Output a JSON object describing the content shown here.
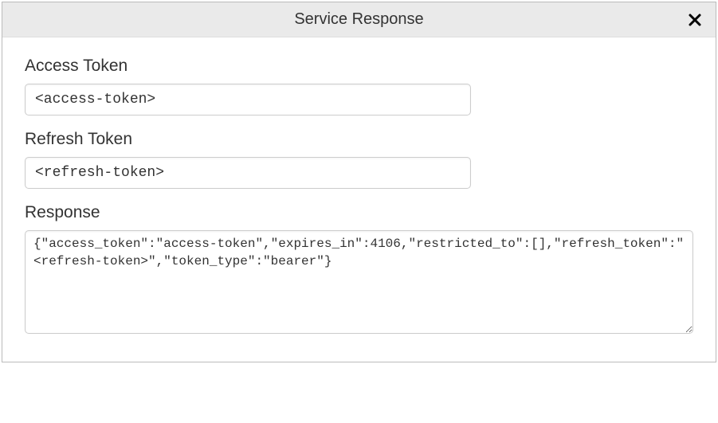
{
  "dialog": {
    "title": "Service Response",
    "fields": {
      "access_token": {
        "label": "Access Token",
        "value": "<access-token>"
      },
      "refresh_token": {
        "label": "Refresh Token",
        "value": "<refresh-token>"
      },
      "response": {
        "label": "Response",
        "value": "{\"access_token\":\"access-token\",\"expires_in\":4106,\"restricted_to\":[],\"refresh_token\":\"<refresh-token>\",\"token_type\":\"bearer\"}"
      }
    }
  }
}
